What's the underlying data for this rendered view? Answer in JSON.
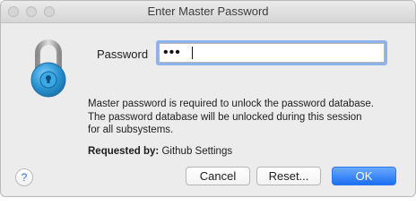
{
  "window": {
    "title": "Enter Master Password"
  },
  "form": {
    "password_label": "Password",
    "password_value": "•••"
  },
  "message": {
    "line1": "Master password is required to unlock the password database.",
    "line2": "The password database will be unlocked during this session",
    "line3": "for all subsystems."
  },
  "requested": {
    "label": "Requested by",
    "separator": ":",
    "value": "Github Settings"
  },
  "buttons": {
    "help": "?",
    "cancel": "Cancel",
    "reset": "Reset...",
    "ok": "OK"
  },
  "colors": {
    "accent": "#1c6ff1",
    "lock_blue": "#2a93d0",
    "focus_ring": "#8db3ec"
  },
  "icons": {
    "lock": "lock-icon",
    "help": "help-icon"
  }
}
